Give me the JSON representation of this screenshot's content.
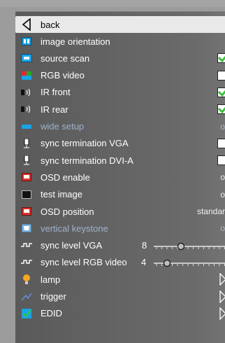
{
  "menu": {
    "back_label": "back",
    "rows": [
      {
        "label": "image orientation",
        "icon": "image-orientation-icon",
        "dim": false,
        "control": "none",
        "value": ""
      },
      {
        "label": "source scan",
        "icon": "source-scan-icon",
        "dim": false,
        "control": "check",
        "checked": true,
        "value": ""
      },
      {
        "label": "RGB video",
        "icon": "rgb-video-icon",
        "dim": false,
        "control": "check",
        "checked": false,
        "value": ""
      },
      {
        "label": "IR front",
        "icon": "ir-front-icon",
        "dim": false,
        "control": "check",
        "checked": true,
        "value": ""
      },
      {
        "label": "IR rear",
        "icon": "ir-rear-icon",
        "dim": false,
        "control": "check",
        "checked": true,
        "value": ""
      },
      {
        "label": "wide setup",
        "icon": "wide-setup-icon",
        "dim": true,
        "control": "text",
        "value": "o"
      },
      {
        "label": "sync termination VGA",
        "icon": "sync-termination-vga-icon",
        "dim": false,
        "control": "check",
        "checked": false,
        "value": ""
      },
      {
        "label": "sync termination DVI-A",
        "icon": "sync-termination-dvi-icon",
        "dim": false,
        "control": "check",
        "checked": false,
        "value": ""
      },
      {
        "label": "OSD enable",
        "icon": "osd-enable-icon",
        "dim": false,
        "control": "text",
        "value": "o"
      },
      {
        "label": "test image",
        "icon": "test-image-icon",
        "dim": false,
        "control": "text",
        "value": "o"
      },
      {
        "label": "OSD position",
        "icon": "osd-position-icon",
        "dim": false,
        "control": "text",
        "value": "standar"
      },
      {
        "label": "vertical keystone",
        "icon": "vertical-keystone-icon",
        "dim": true,
        "control": "text",
        "value": "o"
      },
      {
        "label": "sync level VGA",
        "icon": "sync-level-vga-icon",
        "dim": false,
        "control": "slider",
        "value": "8",
        "level": 0.35
      },
      {
        "label": "sync level RGB video",
        "icon": "sync-level-rgb-icon",
        "dim": false,
        "control": "slider",
        "value": "4",
        "level": 0.15
      },
      {
        "label": "lamp",
        "icon": "lamp-icon",
        "dim": false,
        "control": "arrow",
        "value": ""
      },
      {
        "label": "trigger",
        "icon": "trigger-icon",
        "dim": false,
        "control": "arrow",
        "value": ""
      },
      {
        "label": "EDID",
        "icon": "edid-icon",
        "dim": false,
        "control": "arrow",
        "value": ""
      }
    ]
  },
  "colors": {
    "check_green": "#3cc23c",
    "icon_blue": "#1aa3e6",
    "icon_red": "#d8322a"
  }
}
